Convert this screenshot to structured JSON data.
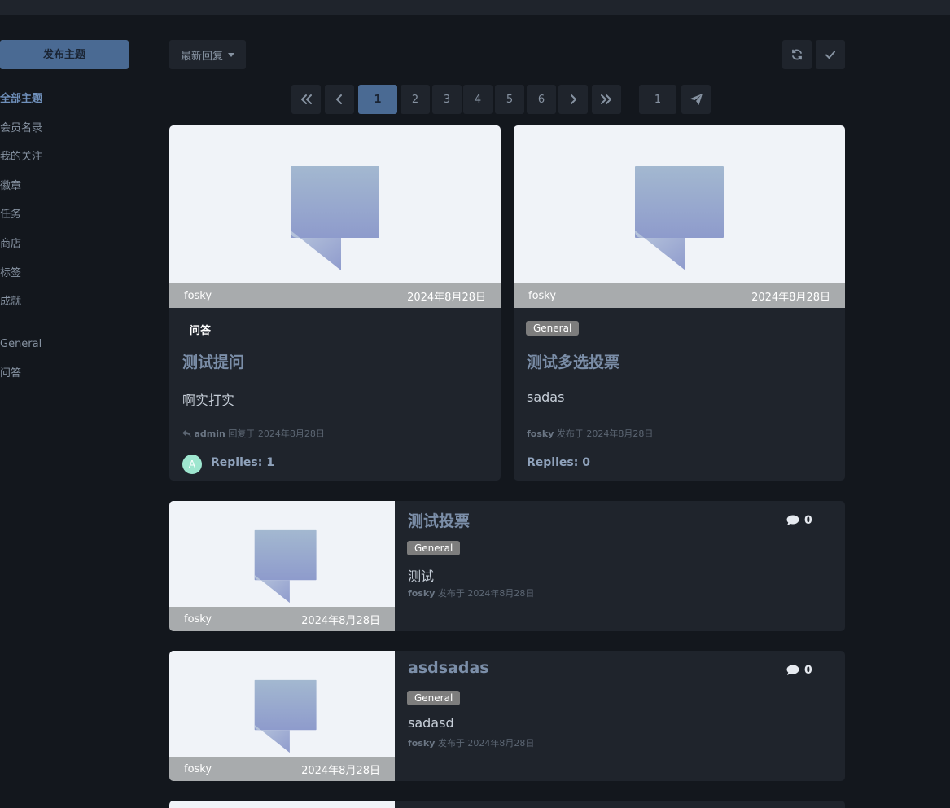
{
  "sidebar": {
    "new_topic_label": "发布主题",
    "items": [
      {
        "label": "全部主题",
        "active": true
      },
      {
        "label": "会员名录"
      },
      {
        "label": "我的关注"
      },
      {
        "label": "徽章"
      },
      {
        "label": "任务"
      },
      {
        "label": "商店"
      },
      {
        "label": "标签"
      },
      {
        "label": "成就"
      }
    ],
    "tags": [
      {
        "label": "General"
      },
      {
        "label": "问答"
      }
    ]
  },
  "toolbar": {
    "sort_label": "最新回复",
    "refresh_icon": "refresh-icon",
    "mark_read_icon": "check-icon"
  },
  "pagination": {
    "pages": [
      "1",
      "2",
      "3",
      "4",
      "5",
      "6"
    ],
    "current": "1",
    "jump_value": "1"
  },
  "cards": [
    {
      "author": "fosky",
      "date": "2024年8月28日",
      "tag": "问答",
      "title": "测试提问",
      "excerpt": "啊实打实",
      "meta_user": "admin",
      "meta_text": " 回复于 2024年8月28日",
      "avatar_letter": "A",
      "replies": "Replies: 1"
    },
    {
      "author": "fosky",
      "date": "2024年8月28日",
      "tag": "General",
      "title": "测试多选投票",
      "excerpt": "sadas",
      "meta_user": "fosky",
      "meta_text": " 发布于 2024年8月28日",
      "replies": "Replies: 0"
    }
  ],
  "list": [
    {
      "author": "fosky",
      "date": "2024年8月28日",
      "title": "测试投票",
      "tag": "General",
      "excerpt": "测试",
      "meta_user": "fosky",
      "meta_text": " 发布于 2024年8月28日",
      "comments": "0"
    },
    {
      "author": "fosky",
      "date": "2024年8月28日",
      "title": "asdsadas",
      "tag": "General",
      "excerpt": "sadasd",
      "meta_user": "fosky",
      "meta_text": " 发布于 2024年8月28日",
      "comments": "0"
    }
  ],
  "colors": {
    "background": "#13171d",
    "panel": "#1f242c",
    "accent": "#4a6a93",
    "title": "#7b8ea8",
    "thumb_bg": "#f0f3f8",
    "meta_strip": "#a8abad"
  }
}
